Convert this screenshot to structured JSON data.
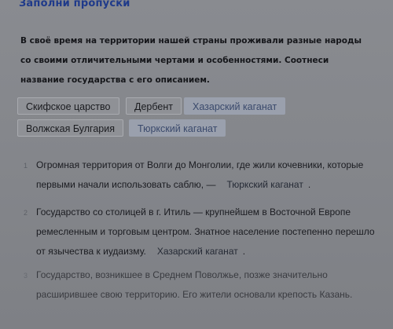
{
  "task": {
    "title": "Заполни пропуски",
    "instruction": "В своё время на территории нашей страны проживали разные народы со своими отличительными чертами и особенностями. Соотнеси название государства с его описанием."
  },
  "options": [
    {
      "label": "Скифское царство",
      "used": false
    },
    {
      "label": "Дербент",
      "used": false
    },
    {
      "label": "Хазарский каганат",
      "used": true
    },
    {
      "label": "Волжская Булгария",
      "used": false
    },
    {
      "label": "Тюркский каганат",
      "used": true
    }
  ],
  "items": [
    {
      "num": "1",
      "text": "Огромная территория от Волги до Монголии, где жили кочевники, которые первыми начали использовать саблю, —",
      "answer": "Тюркский каганат",
      "end": "."
    },
    {
      "num": "2",
      "text": "Государство со столицей в г. Итиль — крупнейшем в Восточной Европе ремесленным и торговым центром. Знатное население постепенно перешло от язычества к иудаизму.",
      "answer": "Хазарский каганат",
      "end": "."
    },
    {
      "num": "3",
      "text": "Государство, возникшее в Среднем Поволжье, позже значительно расширившее свою территорию. Его жители основали крепость Казань.",
      "answer": "",
      "end": ""
    }
  ]
}
